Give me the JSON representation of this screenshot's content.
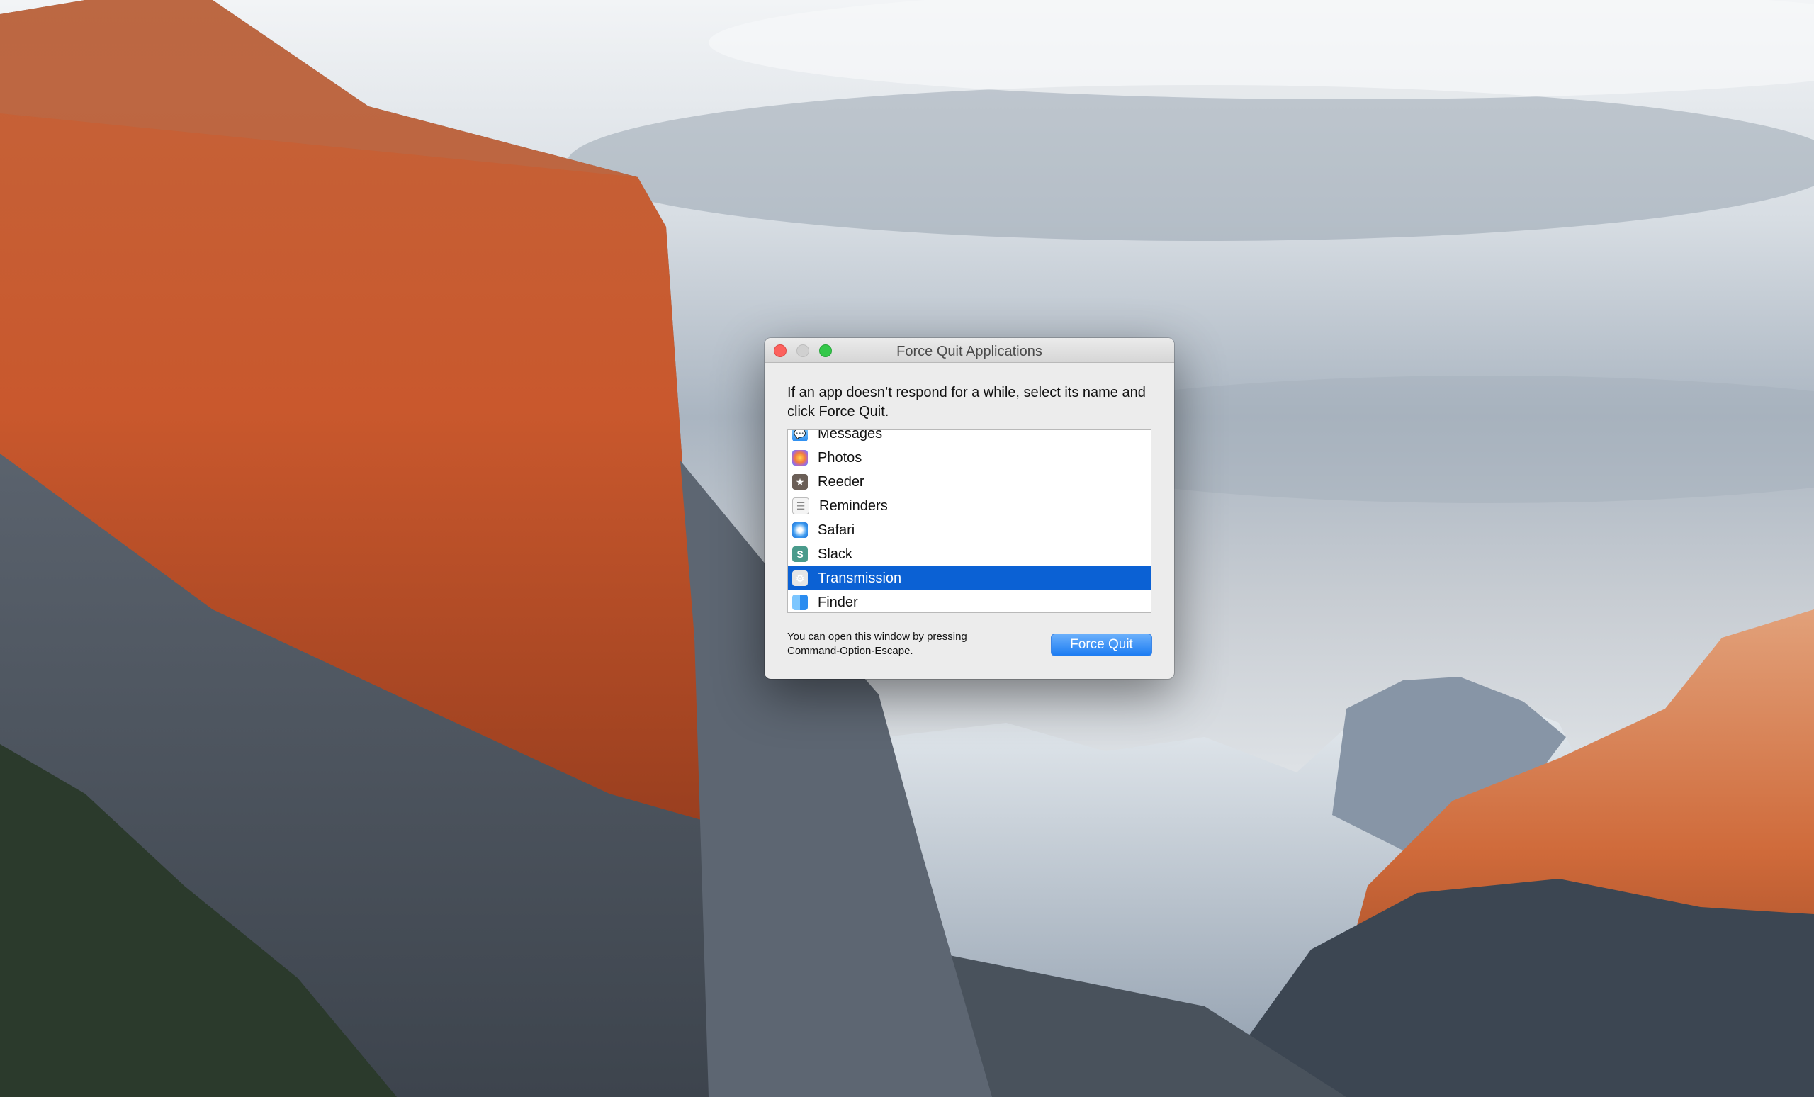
{
  "window": {
    "title": "Force Quit Applications",
    "instructions": "If an app doesn’t respond for a while, select its name and click Force Quit.",
    "hint_line1": "You can open this window by pressing",
    "hint_line2": "Command-Option-Escape.",
    "force_quit_label": "Force Quit"
  },
  "apps": [
    {
      "name": "Messages",
      "icon": "messages-icon",
      "selected": false
    },
    {
      "name": "Photos",
      "icon": "photos-icon",
      "selected": false
    },
    {
      "name": "Reeder",
      "icon": "reeder-icon",
      "selected": false
    },
    {
      "name": "Reminders",
      "icon": "reminders-icon",
      "selected": false
    },
    {
      "name": "Safari",
      "icon": "safari-icon",
      "selected": false
    },
    {
      "name": "Slack",
      "icon": "slack-icon",
      "selected": false
    },
    {
      "name": "Transmission",
      "icon": "transmission-icon",
      "selected": true
    },
    {
      "name": "Finder",
      "icon": "finder-icon",
      "selected": false
    }
  ],
  "colors": {
    "selection": "#0b61d4",
    "close": "#fc615d",
    "zoom": "#34c84a",
    "button": "#1c7cf2"
  }
}
